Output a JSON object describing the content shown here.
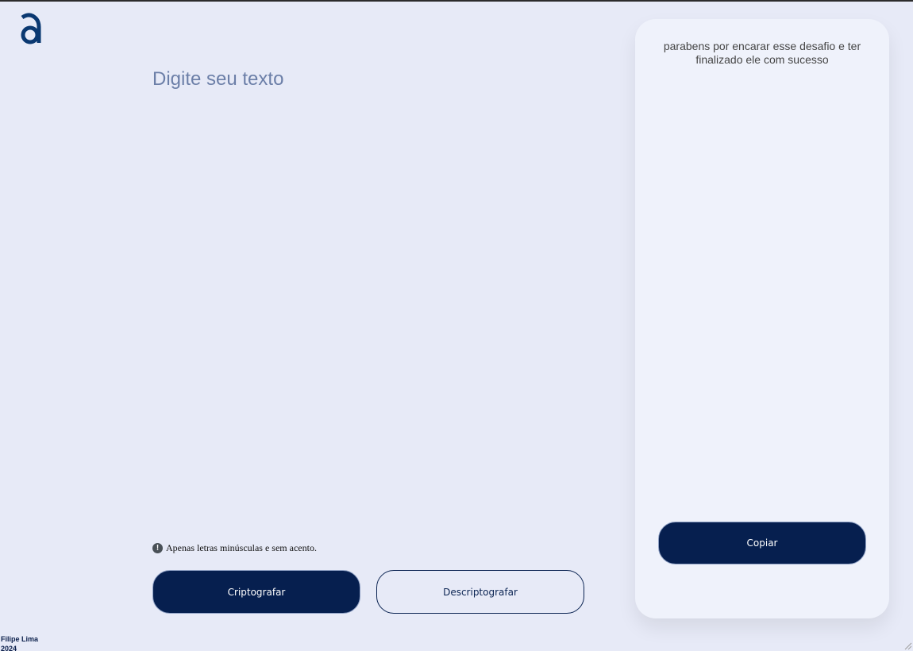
{
  "logo": {
    "icon": "alura-logo",
    "color": "#0a3871"
  },
  "editor": {
    "placeholder": "Digite seu texto",
    "value": ""
  },
  "hint": {
    "icon": "exclamation-circle-icon",
    "text": "Apenas letras minúsculas e sem acento."
  },
  "actions": {
    "encrypt_label": "Criptografar",
    "decrypt_label": "Descriptografar"
  },
  "output": {
    "message": "parabens por encarar esse desafio e ter finalizado ele com sucesso",
    "copy_label": "Copiar"
  },
  "footer": {
    "author": "Filipe Lima",
    "year": "2024"
  },
  "colors": {
    "background": "#e7eaf7",
    "panel": "#eff2fb",
    "primary": "#061f4f",
    "placeholder": "#6c7fa8"
  }
}
